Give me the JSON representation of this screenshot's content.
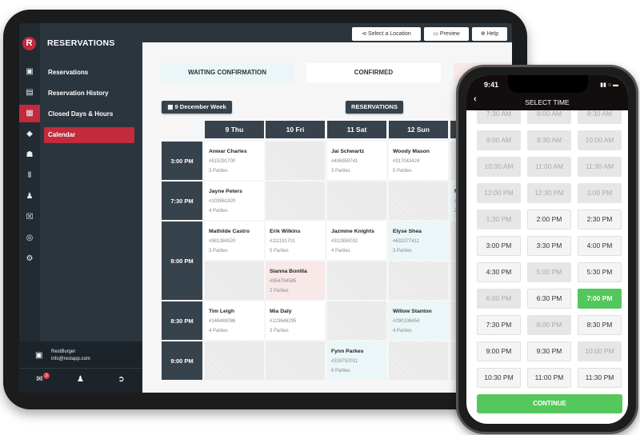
{
  "app": {
    "logo_letter": "R",
    "section_title": "RESERVATIONS"
  },
  "rail_icons": [
    "store-icon",
    "document-icon",
    "calendar-icon",
    "tag-icon",
    "users-icon",
    "chart-icon",
    "user-icon",
    "gift-icon",
    "coins-icon",
    "gear-icon"
  ],
  "sidebar": {
    "items": [
      {
        "label": "Reservations",
        "active": false
      },
      {
        "label": "Reservation History",
        "active": false
      },
      {
        "label": "Closed Days & Hours",
        "active": false
      },
      {
        "label": "Calendar",
        "active": true
      }
    ]
  },
  "account": {
    "name": "RestBurger",
    "email": "info@restapp.com",
    "notifications": "3"
  },
  "toolbar": {
    "location": "Select a Location",
    "preview": "Preview",
    "help": "Help"
  },
  "status_tabs": [
    {
      "label": "WAITING CONFIRMATION",
      "color": "#eaf6f8"
    },
    {
      "label": "CONFIRMED",
      "color": "#ffffff"
    },
    {
      "label": "",
      "color": "#f8e8e8"
    }
  ],
  "week_button": "9 December Week",
  "reservations_button": "RESERVATIONS",
  "calendar": {
    "days": [
      "9 Thu",
      "10 Fri",
      "11 Sat",
      "12 Sun",
      ""
    ],
    "times": [
      "3:00 PM",
      "7:30 PM",
      "8:00 PM",
      "8:30 PM",
      "9:00 PM"
    ],
    "rows": [
      [
        {
          "name": "Anwar Charles",
          "id": "#515291700",
          "parties": "3 Parties",
          "status": "white"
        },
        {
          "status": "hatch"
        },
        {
          "name": "Jai Schwartz",
          "id": "#406959741",
          "parties": "3 Parties",
          "status": "white"
        },
        {
          "name": "Woody Mason",
          "id": "#317043424",
          "parties": "5 Parties",
          "status": "white"
        },
        {
          "status": "hatch"
        }
      ],
      [
        {
          "name": "Jayne Peters",
          "id": "#103961820",
          "parties": "4 Parties",
          "status": "white"
        },
        {
          "status": "hatch"
        },
        {
          "status": "hatch"
        },
        {
          "status": "hatch"
        },
        {
          "name": "M",
          "id": "#",
          "parties": "2",
          "status": "blue"
        }
      ],
      [
        {
          "name": "Mathilde Castro",
          "id": "#981384520",
          "parties": "3 Parties",
          "status": "white"
        },
        {
          "name": "Erik Wilkins",
          "id": "#111191701",
          "parties": "5 Parties",
          "status": "white"
        },
        {
          "name": "Jazmine Knights",
          "id": "#312850032",
          "parties": "4 Parties",
          "status": "white"
        },
        {
          "name": "Elyse Shea",
          "id": "#632277411",
          "parties": "3 Parties",
          "status": "blue"
        },
        {
          "status": "hatch"
        }
      ],
      [
        {
          "status": "hatch"
        },
        {
          "name": "Sianna Bonilla",
          "id": "#954794585",
          "parties": "2 Parties",
          "status": "pink"
        },
        {
          "status": "hatch"
        },
        {
          "status": "hatch"
        },
        {
          "status": "hatch"
        }
      ],
      [
        {
          "name": "Tim Leigh",
          "id": "#148469086",
          "parties": "4 Parties",
          "status": "white"
        },
        {
          "name": "Mia Daly",
          "id": "#123646295",
          "parties": "3 Parties",
          "status": "white"
        },
        {
          "status": "hatch"
        },
        {
          "name": "Willow Stanton",
          "id": "#290108454",
          "parties": "4 Parties",
          "status": "blue"
        },
        {
          "status": "hatch"
        }
      ],
      [
        {
          "status": "hatch"
        },
        {
          "status": "hatch"
        },
        {
          "name": "Fynn Parkes",
          "id": "#318752011",
          "parties": "6 Parties",
          "status": "blue"
        },
        {
          "status": "hatch"
        },
        {
          "status": "hatch"
        }
      ]
    ]
  },
  "phone": {
    "clock": "9:41",
    "title": "SELECT TIME",
    "slots": [
      {
        "label": "7:30 AM",
        "state": "off"
      },
      {
        "label": "8:00 AM",
        "state": "off"
      },
      {
        "label": "8:30 AM",
        "state": "off"
      },
      {
        "label": "9:00 AM",
        "state": "off"
      },
      {
        "label": "9:30 AM",
        "state": "off"
      },
      {
        "label": "10:00 AM",
        "state": "off"
      },
      {
        "label": "10:30 AM",
        "state": "off"
      },
      {
        "label": "11:00 AM",
        "state": "off"
      },
      {
        "label": "11:30 AM",
        "state": "off"
      },
      {
        "label": "12:00 PM",
        "state": "off"
      },
      {
        "label": "12:30 PM",
        "state": "off"
      },
      {
        "label": "1:00 PM",
        "state": "off"
      },
      {
        "label": "1:30 PM",
        "state": "off"
      },
      {
        "label": "2:00 PM",
        "state": "on"
      },
      {
        "label": "2:30 PM",
        "state": "on"
      },
      {
        "label": "3:00 PM",
        "state": "on"
      },
      {
        "label": "3:30 PM",
        "state": "on"
      },
      {
        "label": "4:00 PM",
        "state": "on"
      },
      {
        "label": "4:30 PM",
        "state": "on"
      },
      {
        "label": "5:00 PM",
        "state": "off"
      },
      {
        "label": "5:30 PM",
        "state": "on"
      },
      {
        "label": "6:00 PM",
        "state": "off"
      },
      {
        "label": "6:30 PM",
        "state": "on"
      },
      {
        "label": "7:00 PM",
        "state": "sel"
      },
      {
        "label": "7:30 PM",
        "state": "on"
      },
      {
        "label": "8:00 PM",
        "state": "off"
      },
      {
        "label": "8:30 PM",
        "state": "on"
      },
      {
        "label": "9:00 PM",
        "state": "on"
      },
      {
        "label": "9:30 PM",
        "state": "on"
      },
      {
        "label": "10:00 PM",
        "state": "off"
      },
      {
        "label": "10:30 PM",
        "state": "on"
      },
      {
        "label": "11:00 PM",
        "state": "on"
      },
      {
        "label": "11:30 PM",
        "state": "on"
      }
    ],
    "continue": "CONTINUE"
  }
}
